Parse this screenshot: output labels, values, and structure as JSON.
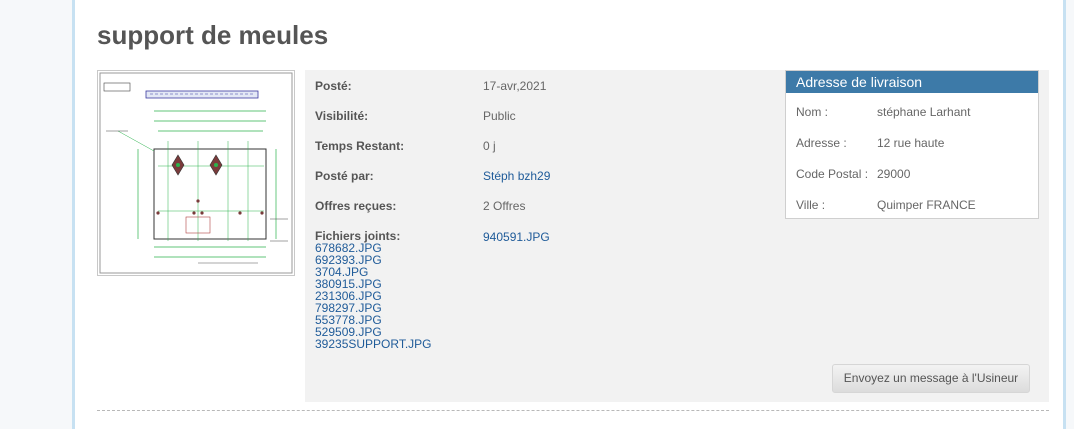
{
  "title": "support de meules",
  "details": {
    "posted_label": "Posté:",
    "posted_value": "17-avr,2021",
    "visibility_label": "Visibilité:",
    "visibility_value": "Public",
    "time_left_label": "Temps Restant:",
    "time_left_value": "0 j",
    "posted_by_label": "Posté par:",
    "posted_by_value": "Stéph bzh29",
    "offers_label": "Offres reçues:",
    "offers_value": "2 Offres",
    "files_label": "Fichiers joints:",
    "files": [
      "678682.JPG",
      "692393.JPG",
      "3704.JPG",
      "380915.JPG",
      "231306.JPG",
      "798297.JPG",
      "553778.JPG",
      "529509.JPG",
      "39235SUPPORT.JPG"
    ],
    "attachment_value": "940591.JPG"
  },
  "address": {
    "header": "Adresse de livraison",
    "name_label": "Nom :",
    "name_value": "stéphane Larhant",
    "address_label": "Adresse :",
    "address_value": "12 rue haute",
    "postal_label": "Code Postal :",
    "postal_value": "29000",
    "city_label": "Ville :",
    "city_value": "Quimper FRANCE"
  },
  "message_button": "Envoyez un message à l'Usineur",
  "colors": {
    "accent": "#3d7aa8",
    "link": "#1f5b99",
    "panel_bg": "#f2f2f2"
  }
}
